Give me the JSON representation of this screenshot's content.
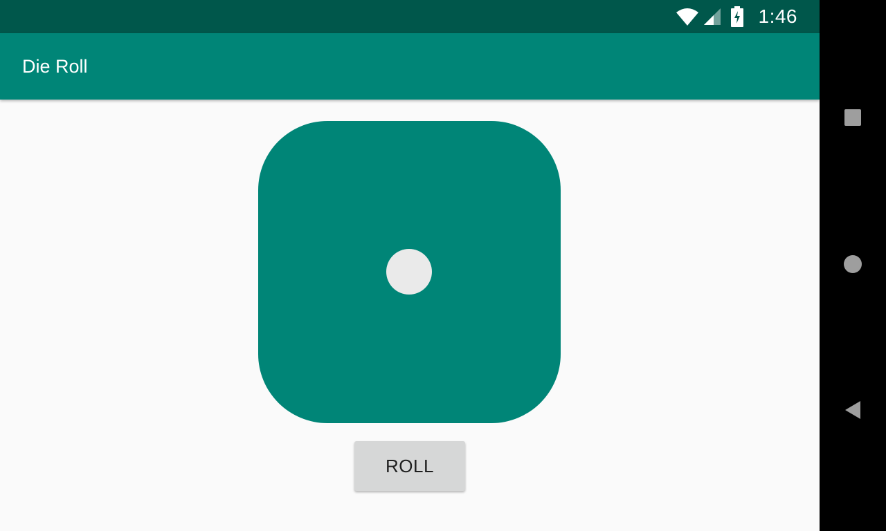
{
  "status_bar": {
    "time": "1:46",
    "icons": [
      "wifi-icon",
      "cell-signal-icon",
      "battery-charging-icon"
    ]
  },
  "app_bar": {
    "title": "Die Roll"
  },
  "main": {
    "die_value": 1,
    "roll_button_label": "ROLL"
  },
  "nav_bar": {
    "buttons": [
      "recents-icon",
      "home-icon",
      "back-icon"
    ]
  },
  "colors": {
    "primary": "#008577",
    "primary_dark": "#00574B",
    "background": "#FAFAFA",
    "button": "#D6D7D7",
    "pip": "#EAEAEA"
  }
}
